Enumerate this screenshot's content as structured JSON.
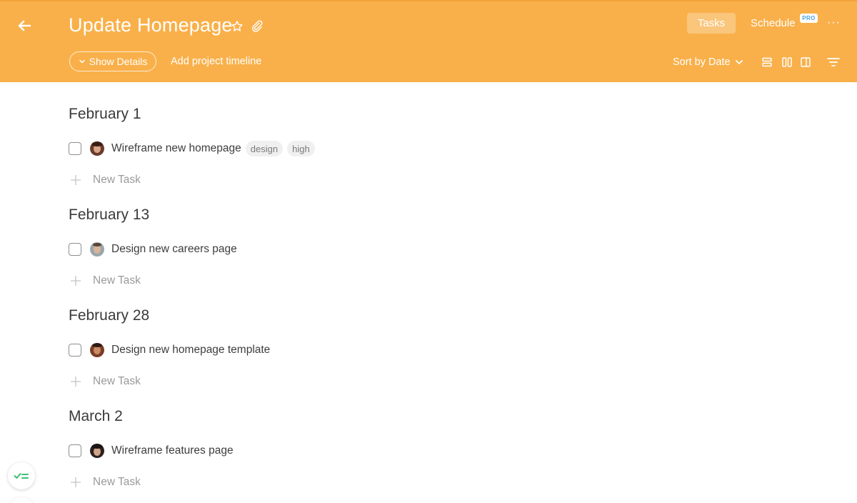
{
  "header": {
    "title": "Update Homepage",
    "tabs": {
      "tasks": "Tasks",
      "schedule": "Schedule",
      "pro_badge": "PRO"
    },
    "more": "···",
    "show_details": "Show Details",
    "add_timeline": "Add project timeline",
    "sort_label": "Sort by Date",
    "colors": {
      "background": "#f9b04a",
      "text": "#ffffff"
    }
  },
  "groups": [
    {
      "date": "February 1",
      "tasks": [
        {
          "name": "Wireframe new homepage",
          "tags": [
            "design",
            "high"
          ]
        }
      ],
      "new_task_label": "New Task"
    },
    {
      "date": "February 13",
      "tasks": [
        {
          "name": "Design new careers page",
          "tags": []
        }
      ],
      "new_task_label": "New Task"
    },
    {
      "date": "February 28",
      "tasks": [
        {
          "name": "Design new homepage template",
          "tags": []
        }
      ],
      "new_task_label": "New Task"
    },
    {
      "date": "March 2",
      "tasks": [
        {
          "name": "Wireframe features page",
          "tags": []
        }
      ],
      "new_task_label": "New Task"
    }
  ]
}
